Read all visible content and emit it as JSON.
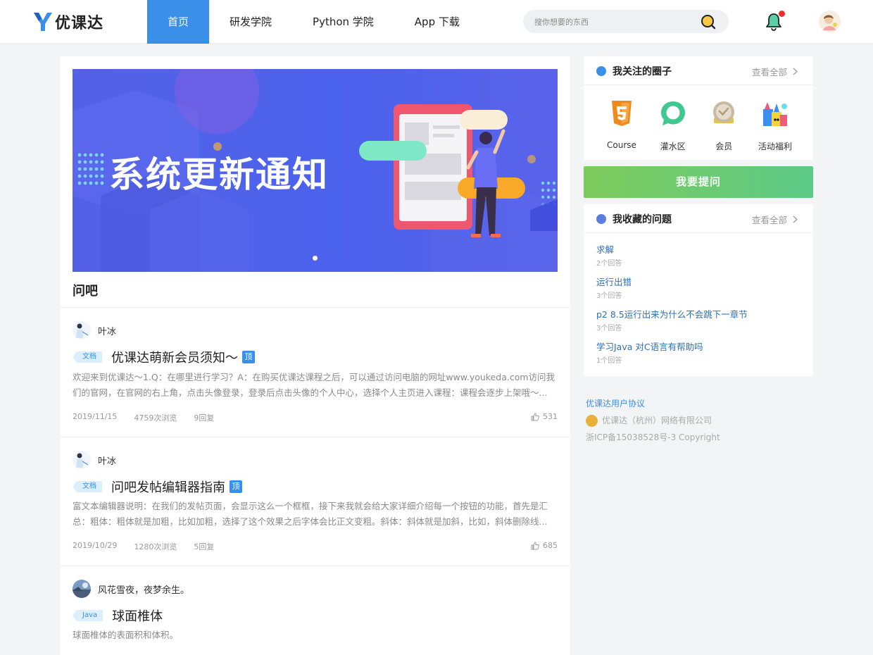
{
  "header": {
    "logo_text": "优课达",
    "nav": [
      {
        "label": "首页",
        "active": true
      },
      {
        "label": "研发学院",
        "active": false
      },
      {
        "label": "Python 学院",
        "active": false
      },
      {
        "label": "App 下载",
        "active": false
      }
    ],
    "search_placeholder": "搜你想要的东西",
    "notification_dot_color": "#ee2b2b"
  },
  "banner": {
    "title": "系统更新通知"
  },
  "section": {
    "title": "问吧"
  },
  "posts": [
    {
      "author": "叶冰",
      "tag": "文档",
      "title": "优课达萌新会员须知～",
      "pinned": true,
      "top_badge": "顶",
      "excerpt": "欢迎来到优课达～1.Q：在哪里进行学习？A：在购买优课达课程之后，可以通过访问电脑的网址www.youkeda.com访问我们的官网，在官网的右上角，点击头像登录，登录后点击头像的个人中心，选择个人主页进入课程：课程会逐步上架哦～...",
      "date": "2019/11/15",
      "views": "4759次浏览",
      "replies": "9回复",
      "likes": "531"
    },
    {
      "author": "叶冰",
      "tag": "文档",
      "title": "问吧发帖编辑器指南",
      "pinned": true,
      "top_badge": "顶",
      "excerpt": "富文本编辑器说明：在我们的发帖页面，会显示这么一个框框，接下来我就会给大家详细介绍每一个按钮的功能，首先是汇总：粗体：粗体就是加粗，比如加粗，选择了这个效果之后字体会比正文变粗。斜体：斜体就是加斜，比如，斜体删除线...",
      "date": "2019/10/29",
      "views": "1280次浏览",
      "replies": "5回复",
      "likes": "685"
    },
    {
      "author": "风花雪夜，夜梦余生。",
      "tag": "Java",
      "title": "球面椎体",
      "pinned": false,
      "excerpt": "球面椎体的表面积和体积。"
    }
  ],
  "circles_card": {
    "title": "我关注的圈子",
    "more": "查看全部",
    "items": [
      {
        "label": "Course",
        "icon": "html5-icon"
      },
      {
        "label": "灌水区",
        "icon": "chat-bubble-icon"
      },
      {
        "label": "会员",
        "icon": "medal-icon"
      },
      {
        "label": "活动福利",
        "icon": "gift-box-icon"
      }
    ]
  },
  "ask_button": "我要提问",
  "favorites_card": {
    "title": "我收藏的问题",
    "more": "查看全部",
    "items": [
      {
        "title": "求解",
        "count": "2个回答"
      },
      {
        "title": "运行出错",
        "count": "3个回答"
      },
      {
        "title": "p2 8.5运行出来为什么不会跳下一章节",
        "count": "3个回答"
      },
      {
        "title": "学习Java 对C语言有帮助吗",
        "count": "1个回答"
      }
    ]
  },
  "footer": {
    "agreement": "优课达用户协议",
    "company": "优课达（杭州）网络有限公司",
    "icp": "浙ICP备15038528号-3 Copyright"
  },
  "colors": {
    "accent": "#3a8fe8",
    "ask_gradient_start": "#7fcb5c",
    "ask_gradient_end": "#5bca86",
    "link": "#2f6fb3"
  }
}
